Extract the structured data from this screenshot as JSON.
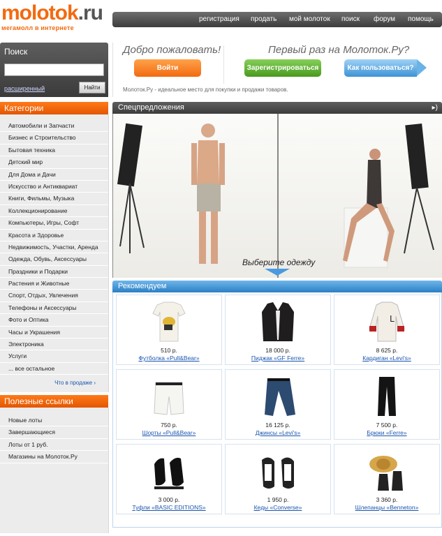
{
  "logo": {
    "name_main": "molotok",
    "name_suffix": ".ru",
    "tagline": "мегамолл в интернете"
  },
  "topnav": [
    "регистрация",
    "продать",
    "мой молоток",
    "поиск",
    "форум",
    "помощь"
  ],
  "search": {
    "title": "Поиск",
    "value": "",
    "advanced_label": "расширенный",
    "button_label": "Найти"
  },
  "welcome": {
    "title_left": "Добро пожаловать!",
    "title_right": "Первый раз на Молоток.Ру?",
    "login_label": "Войти",
    "register_label": "Зарегистрироваться",
    "howto_label": "Как пользоваться?",
    "description": "Молоток.Ру - идеальное место для покупки и продажи товаров."
  },
  "categories": {
    "title": "Категории",
    "items": [
      "Автомобили и Запчасти",
      "Бизнес и Строительство",
      "Бытовая техника",
      "Детский мир",
      "Для Дома и Дачи",
      "Искусство и Антиквариат",
      "Книги, Фильмы, Музыка",
      "Коллекционирование",
      "Компьютеры, Игры, Софт",
      "Красота и Здоровье",
      "Недвижимость, Участки, Аренда",
      "Одежда, Обувь, Аксессуары",
      "Праздники и Подарки",
      "Растения и Животные",
      "Спорт, Отдых, Увлечения",
      "Телефоны и Аксессуары",
      "Фото и Оптика",
      "Часы и Украшения",
      "Электроника",
      "Услуги",
      "... все остальное"
    ],
    "more_link": "Что в продаже ›"
  },
  "useful_links": {
    "title": "Полезные ссылки",
    "items": [
      "Новые лоты",
      "Завершающиеся",
      "Лоты от 1 руб.",
      "Магазины на Молоток.Ру"
    ]
  },
  "special_offers": {
    "title": "Спецпредложения",
    "caption": "Выберите одежду"
  },
  "recommended": {
    "title": "Рекомендуем",
    "items": [
      {
        "price": "510 р.",
        "name": "Футболка «Pull&Bear»",
        "icon": "tshirt-icon"
      },
      {
        "price": "18 000 р.",
        "name": "Пиджак «GF Ferre»",
        "icon": "jacket-icon"
      },
      {
        "price": "8 625 р.",
        "name": "Кардиган «Levi's»",
        "icon": "cardigan-icon"
      },
      {
        "price": "750 р.",
        "name": "Шорты «Pull&Bear»",
        "icon": "shorts-icon"
      },
      {
        "price": "16 125 р.",
        "name": "Джинсы «Levi's»",
        "icon": "jeans-icon"
      },
      {
        "price": "7 500 р.",
        "name": "Брюки «Ferre»",
        "icon": "trousers-icon"
      },
      {
        "price": "3 000 р.",
        "name": "Туфли «BASIC EDITIONS»",
        "icon": "shoes-icon"
      },
      {
        "price": "1 950 р.",
        "name": "Кеды «Converse»",
        "icon": "sneakers-icon"
      },
      {
        "price": "3 360 р.",
        "name": "Шлепанцы «Benneton»",
        "icon": "sandals-icon"
      }
    ]
  },
  "colors": {
    "accent": "#f26a10",
    "header_dark": "#444444",
    "recommend_blue": "#3a8fd4",
    "link": "#1a55b0"
  }
}
